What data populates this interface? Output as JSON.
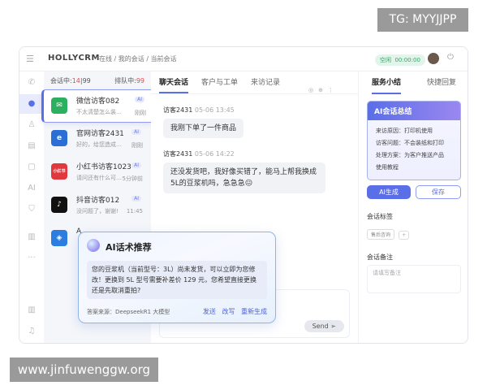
{
  "watermarks": {
    "top": "TG: MYYJJPP",
    "bottom": "www.jinfuwenggw.org"
  },
  "header": {
    "brand": "HOLLYCRM",
    "breadcrumb": "在线 / 我的会话 / 当前会话",
    "status": "空闲",
    "timer": "00:00:00"
  },
  "rail": [
    {
      "icon": "phone-icon",
      "g": "✆"
    },
    {
      "icon": "chat-icon",
      "g": "●"
    },
    {
      "icon": "user-icon",
      "g": "♙"
    },
    {
      "icon": "clipboard-icon",
      "g": "▤"
    },
    {
      "icon": "message-icon",
      "g": "▢"
    },
    {
      "icon": "ai-icon",
      "g": "AI"
    },
    {
      "icon": "shield-icon",
      "g": "⛉"
    },
    {
      "icon": "chart-icon",
      "g": "▥"
    },
    {
      "icon": "more-icon",
      "g": "···"
    }
  ],
  "sessions": {
    "in_label": "会话中:",
    "in_count": "14",
    "in_total": "|99",
    "queue_label": "排队中:",
    "queue_count": "99",
    "items": [
      {
        "name": "微信访客082",
        "preview": "不太清楚怎么装…",
        "time": "刚刚",
        "badge": "AI",
        "icon": "wechat-icon",
        "color": "#2bb05f",
        "g": "✉"
      },
      {
        "name": "官网访客2431",
        "preview": "好的，给您造成…",
        "time": "刚刚",
        "badge": "AI",
        "icon": "ie-icon",
        "color": "#2b6fd6",
        "g": "e"
      },
      {
        "name": "小红书访客1023",
        "preview": "请问还有什么可…",
        "time": "5分钟前",
        "badge": "AI",
        "icon": "xiaohongshu-icon",
        "color": "#e0383e",
        "g": "小红书"
      },
      {
        "name": "抖音访客012",
        "preview": "没问题了，谢谢!",
        "time": "11:45",
        "badge": "AI",
        "icon": "douyin-icon",
        "color": "#111111",
        "g": "♪"
      },
      {
        "name": "A",
        "preview": "",
        "time": "",
        "badge": "",
        "icon": "app-icon",
        "color": "#2b7de0",
        "g": "◈"
      }
    ]
  },
  "chat": {
    "tabs": [
      "聊天会话",
      "客户与工单",
      "来访记录"
    ],
    "messages": [
      {
        "sender": "访客2431",
        "time": "05-06 13:45",
        "text": "我刚下单了一件商品"
      },
      {
        "sender": "访客2431",
        "time": "05-06 14:22",
        "text": "还没发货吧，我好像买错了，能马上帮我换成5L的豆浆机吗，急急急😖"
      }
    ],
    "send": "Send"
  },
  "right": {
    "tabs": [
      "服务小结",
      "快捷回复"
    ],
    "summary_title": "AI会话总结",
    "summary": [
      "来访原因：打印机使用",
      "访客问题：不会装纸和打印",
      "处理方案：为客户推送产品",
      "使用教程"
    ],
    "generate": "AI生成",
    "save": "保存",
    "tags_label": "会话标签",
    "tag": "售后咨询",
    "notes_label": "会话备注",
    "notes_placeholder": "请填写备注"
  },
  "popup": {
    "title": "AI话术推荐",
    "text": "您的豆浆机（当前型号：3L）尚未发货，可以立即为您修改！更换到 5L 型号需要补差价 129 元，您希望直接更换还是先取消重拍?",
    "source": "答案来源：DeepseekR1 大模型",
    "actions": [
      "发送",
      "改写",
      "重新生成"
    ]
  }
}
